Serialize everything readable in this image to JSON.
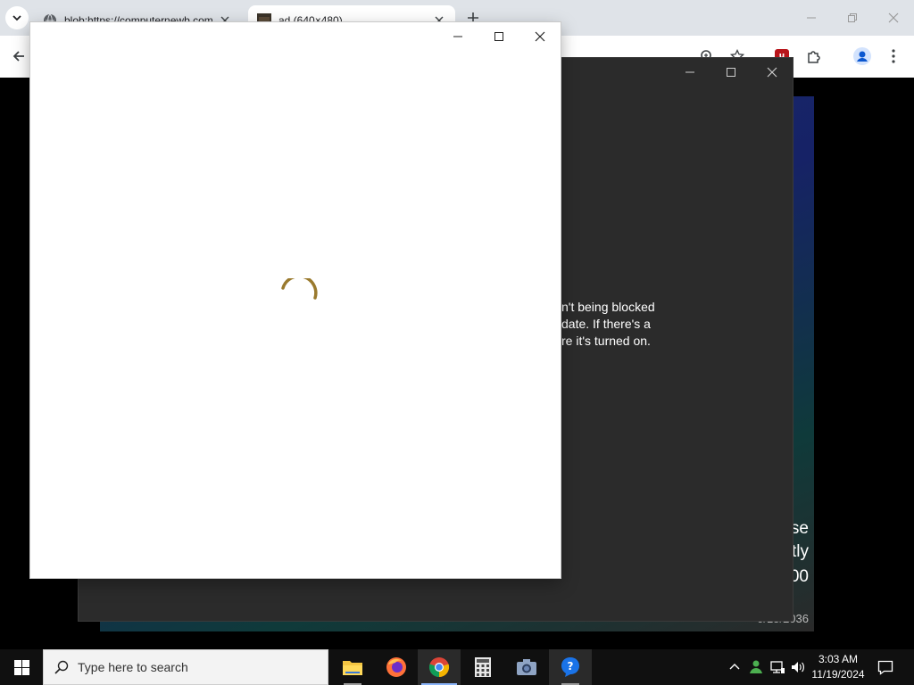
{
  "browser": {
    "tabs": [
      {
        "title": "blob:https://computernewb.com"
      },
      {
        "title": "ad (640×480)"
      }
    ]
  },
  "dark_window": {
    "text_lines": [
      "n't being blocked",
      "date. If there's a",
      "re it's turned on."
    ]
  },
  "background_page": {
    "text_lines": [
      "se",
      "tly",
      "00",
      "0/15/2036"
    ]
  },
  "taskbar": {
    "search_placeholder": "Type here to search",
    "time": "3:03 AM",
    "date": "11/19/2024"
  },
  "colors": {
    "spinner": "#9a7a2e",
    "taskbar": "#101010",
    "dark_window": "#2b2b2b",
    "accent": "#8ab4f8"
  },
  "icons": {
    "tab_menu": "chevron-down-icon",
    "tab1_favicon": "globe-icon",
    "tab2_favicon": "image-thumbnail-icon",
    "back": "arrow-left-icon",
    "start": "windows-logo-icon",
    "search": "magnifier-icon"
  }
}
